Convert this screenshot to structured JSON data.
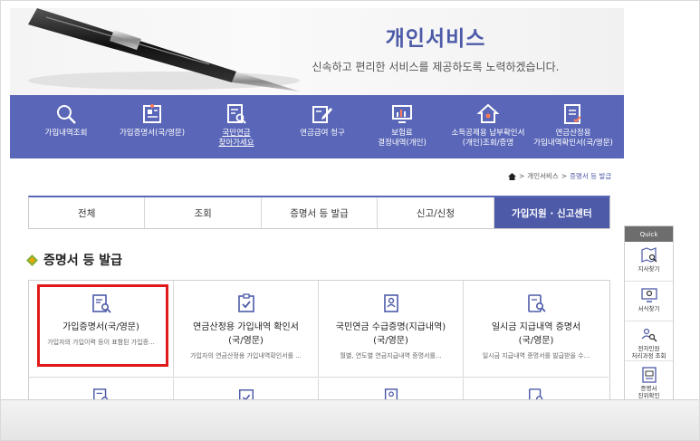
{
  "hero": {
    "title": "개인서비스",
    "subtitle": "신속하고 편리한 서비스를 제공하도록 노력하겠습니다."
  },
  "services": [
    {
      "label": "가입내역조회",
      "icon": "magnifier-icon"
    },
    {
      "label": "가입증명서(국/영문)",
      "icon": "certificate-icon"
    },
    {
      "label": "국민연금\n찾아가세요",
      "icon": "document-search-icon"
    },
    {
      "label": "연금급여 청구",
      "icon": "edit-document-icon"
    },
    {
      "label": "보험료\n결정내역(개인)",
      "icon": "monitor-icon"
    },
    {
      "label": "소득공제용 납부확인서\n(개인)조회/증명",
      "icon": "house-icon"
    },
    {
      "label": "연금산정용\n가입내역확인서(국/영문)",
      "icon": "checklist-icon"
    }
  ],
  "breadcrumb": {
    "home_icon": "home-icon",
    "items": [
      "개인서비스",
      "증명서 등 발급"
    ]
  },
  "tabs": [
    {
      "label": "전체",
      "active": false
    },
    {
      "label": "조회",
      "active": false
    },
    {
      "label": "증명서 등 발급",
      "active": false
    },
    {
      "label": "신고/신청",
      "active": false
    },
    {
      "label": "가입지원 · 신고센터",
      "active": true
    }
  ],
  "section": {
    "title": "증명서 등 발급"
  },
  "cards": [
    {
      "title": "가입증명서(국/영문)",
      "desc": "가입자의 가입이력 등이 표함된 가입증...",
      "icon": "doc-search-icon"
    },
    {
      "title": "연금산정용 가입내역 확인서\n(국/영문)",
      "desc": "가입자의 연금산정용 가입내역확인서를 ...",
      "icon": "clipboard-check-icon"
    },
    {
      "title": "국민연금 수급증명(지급내역)\n(국/영문)",
      "desc": "월별, 연도별 연금지급내역 증명서를...",
      "icon": "id-badge-icon"
    },
    {
      "title": "일시금 지급내역 증명서\n(국/영문)",
      "desc": "일시금 지급내역 증명서를 발급받을 수...",
      "icon": "tablet-search-icon"
    }
  ],
  "quick": {
    "header": "Quick",
    "items": [
      {
        "label": "지사찾기",
        "icon": "map-search-icon"
      },
      {
        "label": "서식찾기",
        "icon": "monitor-search-icon"
      },
      {
        "label": "전자민원\n처리과정 조회",
        "icon": "people-search-icon"
      },
      {
        "label": "증명서\n진위확인",
        "icon": "certificate-check-icon"
      }
    ]
  },
  "colors": {
    "brand": "#5a67b8",
    "active_tab": "#4d5aa8",
    "highlight": "#e01a1a",
    "accent": "#f0a500"
  }
}
